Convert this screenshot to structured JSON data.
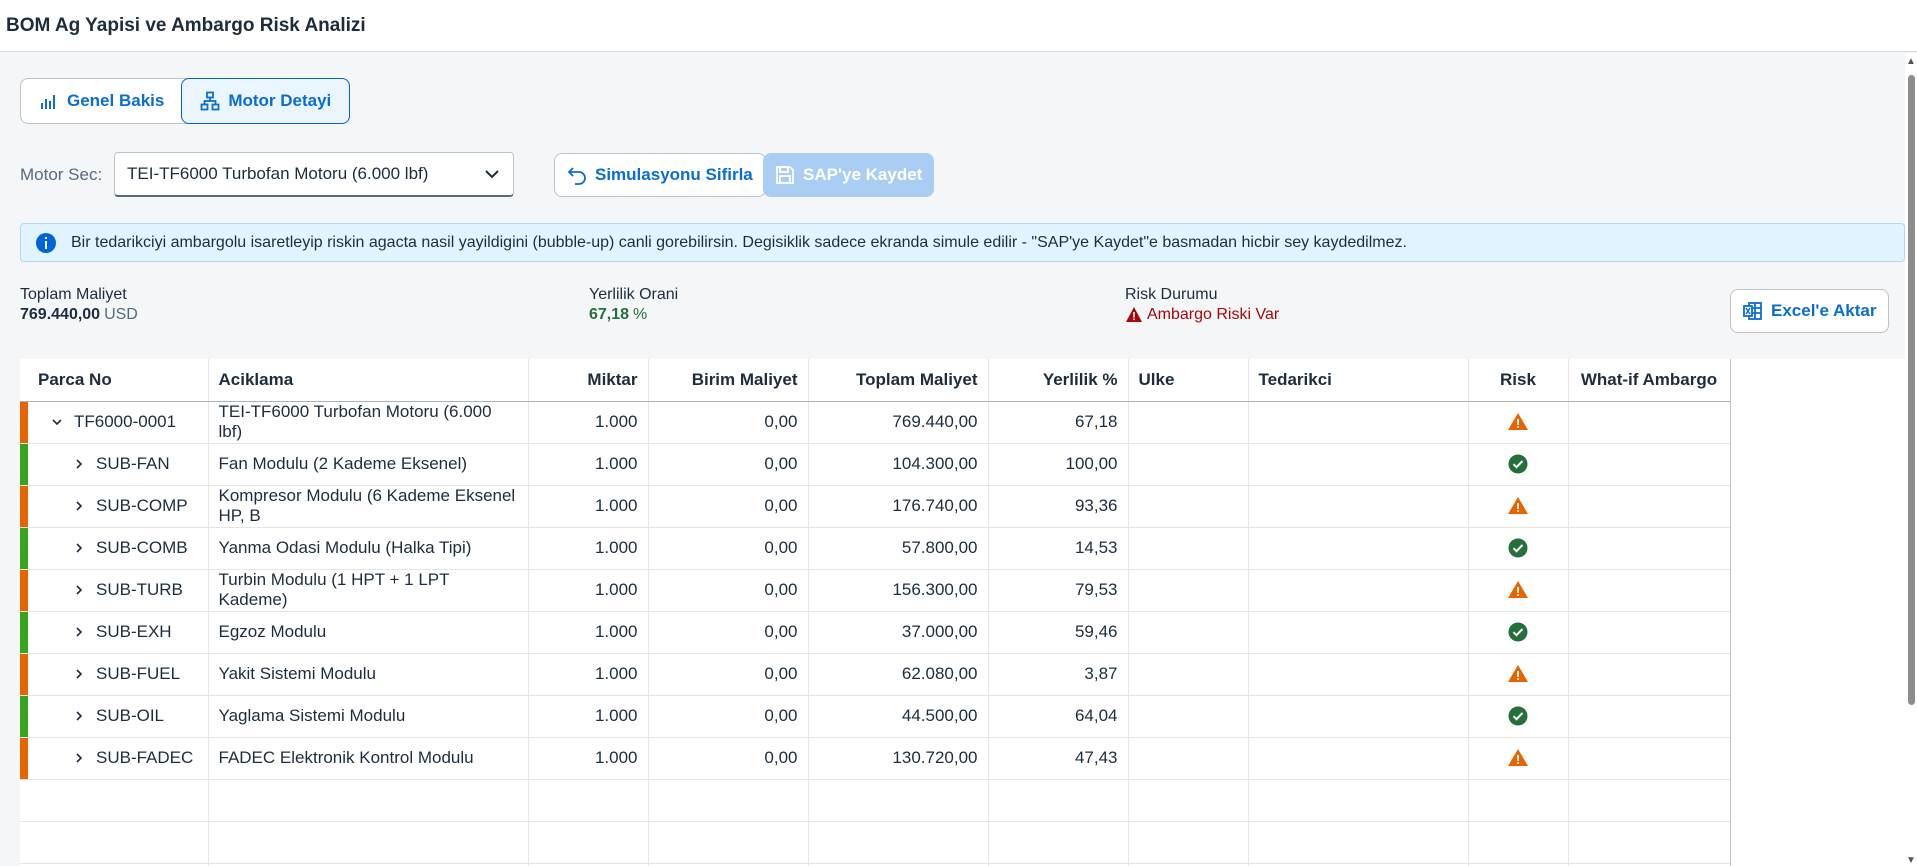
{
  "app": {
    "title": "BOM Ag Yapisi ve Ambargo Risk Analizi"
  },
  "tabs": [
    {
      "label": "Genel Bakis",
      "icon": "bar-chart-icon",
      "active": false
    },
    {
      "label": "Motor Detayi",
      "icon": "org-chart-icon",
      "active": true
    }
  ],
  "motor": {
    "label": "Motor Sec:",
    "selected": "TEI-TF6000 Turbofan Motoru (6.000 lbf)"
  },
  "actions": {
    "reset_label": "Simulasyonu Sifirla",
    "save_label": "SAP'ye Kaydet",
    "excel_label": "Excel'e Aktar"
  },
  "info": {
    "text": "Bir tedarikciyi ambargolu isaretleyip riskin agacta nasil yayildigini (bubble-up) canli gorebilirsin. Degisiklik sadece ekranda simule edilir - \"SAP'ye Kaydet\"e basmadan hicbir sey kaydedilmez."
  },
  "kpis": {
    "total_cost": {
      "label": "Toplam Maliyet",
      "value": "769.440,00",
      "unit": "USD"
    },
    "locality": {
      "label": "Yerlilik Orani",
      "value": "67,18",
      "unit": "%"
    },
    "risk": {
      "label": "Risk Durumu",
      "value": "Ambargo Riski Var"
    }
  },
  "table": {
    "columns": [
      "Parca No",
      "Aciklama",
      "Miktar",
      "Birim Maliyet",
      "Toplam Maliyet",
      "Yerlilik %",
      "Ulke",
      "Tedarikci",
      "Risk",
      "What-if Ambargo"
    ],
    "rows": [
      {
        "highlight": "orange",
        "expander": "expanded",
        "level": 0,
        "parca": "TF6000-0001",
        "aciklama": "TEI-TF6000 Turbofan Motoru (6.000 lbf)",
        "miktar": "1.000",
        "birim": "0,00",
        "toplam": "769.440,00",
        "yerlilik": "67,18",
        "ulke": "",
        "tedarikci": "",
        "risk": "warning"
      },
      {
        "highlight": "green",
        "expander": "collapsed",
        "level": 1,
        "parca": "SUB-FAN",
        "aciklama": "Fan Modulu (2 Kademe Eksenel)",
        "miktar": "1.000",
        "birim": "0,00",
        "toplam": "104.300,00",
        "yerlilik": "100,00",
        "ulke": "",
        "tedarikci": "",
        "risk": "ok"
      },
      {
        "highlight": "orange",
        "expander": "collapsed",
        "level": 1,
        "parca": "SUB-COMP",
        "aciklama": "Kompresor Modulu (6 Kademe Eksenel HP, B",
        "miktar": "1.000",
        "birim": "0,00",
        "toplam": "176.740,00",
        "yerlilik": "93,36",
        "ulke": "",
        "tedarikci": "",
        "risk": "warning"
      },
      {
        "highlight": "green",
        "expander": "collapsed",
        "level": 1,
        "parca": "SUB-COMB",
        "aciklama": "Yanma Odasi Modulu (Halka Tipi)",
        "miktar": "1.000",
        "birim": "0,00",
        "toplam": "57.800,00",
        "yerlilik": "14,53",
        "ulke": "",
        "tedarikci": "",
        "risk": "ok"
      },
      {
        "highlight": "orange",
        "expander": "collapsed",
        "level": 1,
        "parca": "SUB-TURB",
        "aciklama": "Turbin Modulu (1 HPT + 1 LPT Kademe)",
        "miktar": "1.000",
        "birim": "0,00",
        "toplam": "156.300,00",
        "yerlilik": "79,53",
        "ulke": "",
        "tedarikci": "",
        "risk": "warning"
      },
      {
        "highlight": "green",
        "expander": "collapsed",
        "level": 1,
        "parca": "SUB-EXH",
        "aciklama": "Egzoz Modulu",
        "miktar": "1.000",
        "birim": "0,00",
        "toplam": "37.000,00",
        "yerlilik": "59,46",
        "ulke": "",
        "tedarikci": "",
        "risk": "ok"
      },
      {
        "highlight": "orange",
        "expander": "collapsed",
        "level": 1,
        "parca": "SUB-FUEL",
        "aciklama": "Yakit Sistemi Modulu",
        "miktar": "1.000",
        "birim": "0,00",
        "toplam": "62.080,00",
        "yerlilik": "3,87",
        "ulke": "",
        "tedarikci": "",
        "risk": "warning"
      },
      {
        "highlight": "green",
        "expander": "collapsed",
        "level": 1,
        "parca": "SUB-OIL",
        "aciklama": "Yaglama Sistemi Modulu",
        "miktar": "1.000",
        "birim": "0,00",
        "toplam": "44.500,00",
        "yerlilik": "64,04",
        "ulke": "",
        "tedarikci": "",
        "risk": "ok"
      },
      {
        "highlight": "orange",
        "expander": "collapsed",
        "level": 1,
        "parca": "SUB-FADEC",
        "aciklama": "FADEC Elektronik Kontrol Modulu",
        "miktar": "1.000",
        "birim": "0,00",
        "toplam": "130.720,00",
        "yerlilik": "47,43",
        "ulke": "",
        "tedarikci": "",
        "risk": "warning"
      }
    ],
    "empty_rows": 3
  },
  "colors": {
    "accent": "#0a6ed1",
    "warning": "#e76500",
    "success": "#256f3a",
    "error": "#aa0808"
  }
}
